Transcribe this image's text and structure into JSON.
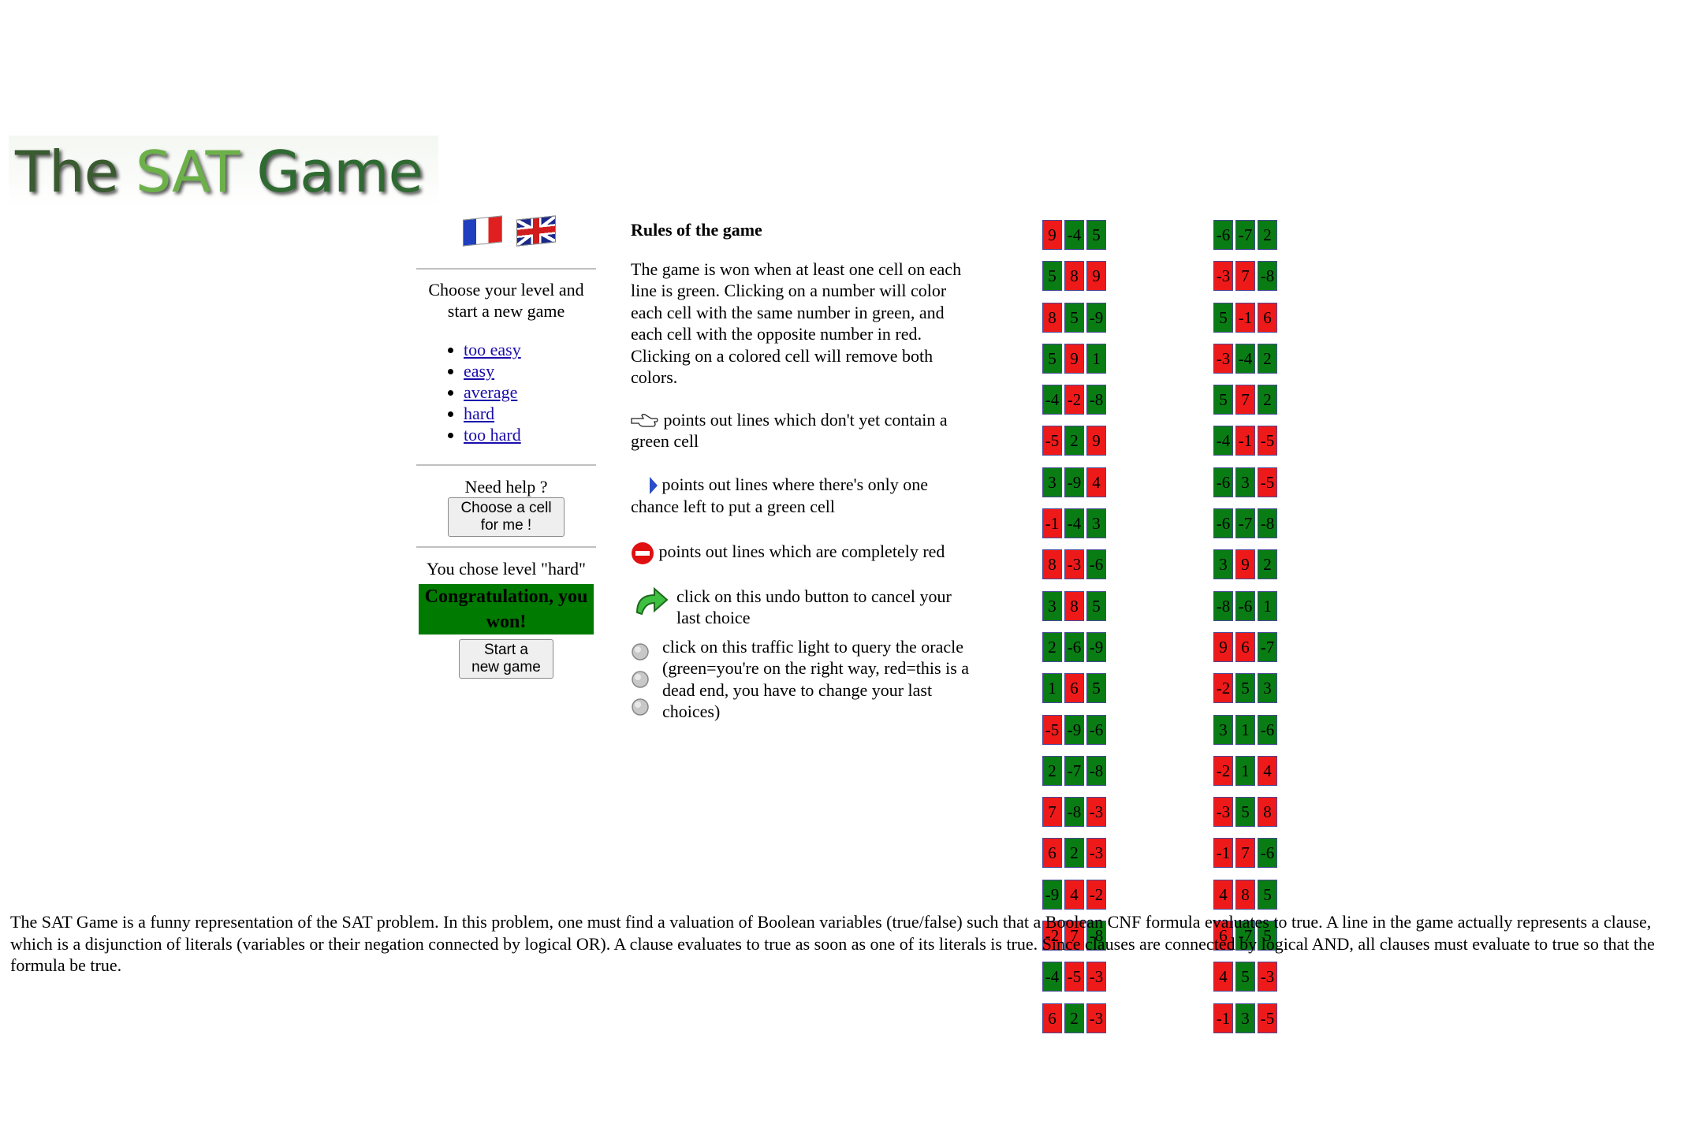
{
  "logo": {
    "the": "The",
    "sat": "SAT",
    "game": "Game"
  },
  "left": {
    "choose_text": "Choose your level and start a new game",
    "levels": [
      "too easy",
      "easy",
      "average",
      "hard",
      "too hard"
    ],
    "help_title": "Need help ?",
    "help_button": "Choose a cell for me !",
    "chosen_text": "You chose level \"hard\"",
    "congrats": "Congratulation, you won!",
    "new_game_button": "Start a new game"
  },
  "rules": {
    "title": "Rules of the game",
    "intro": "The game is won when at least one cell on each line is green. Clicking on a number will color each cell with the same number in green, and each cell with the opposite number in red. Clicking on a colored cell will remove both colors.",
    "hand_rule": "points out lines which don't yet contain a green cell",
    "arrow_rule": "points out lines where there's only one chance left to put a green cell",
    "stop_rule": "points out lines which are completely red",
    "undo_rule": "click on this undo button to cancel your last choice",
    "light_rule": "click on this traffic light to query the oracle (green=you're on the right way, red=this is a dead end, you have to change your last choices)"
  },
  "grid_left": [
    [
      [
        "9",
        "r"
      ],
      [
        "-4",
        "g"
      ],
      [
        "5",
        "g"
      ]
    ],
    [
      [
        "5",
        "g"
      ],
      [
        "8",
        "r"
      ],
      [
        "9",
        "r"
      ]
    ],
    [
      [
        "8",
        "r"
      ],
      [
        "5",
        "g"
      ],
      [
        "-9",
        "g"
      ]
    ],
    [
      [
        "5",
        "g"
      ],
      [
        "9",
        "r"
      ],
      [
        "1",
        "g"
      ]
    ],
    [
      [
        "-4",
        "g"
      ],
      [
        "-2",
        "r"
      ],
      [
        "-8",
        "g"
      ]
    ],
    [
      [
        "-5",
        "r"
      ],
      [
        "2",
        "g"
      ],
      [
        "9",
        "r"
      ]
    ],
    [
      [
        "3",
        "g"
      ],
      [
        "-9",
        "g"
      ],
      [
        "4",
        "r"
      ]
    ],
    [
      [
        "-1",
        "r"
      ],
      [
        "-4",
        "g"
      ],
      [
        "3",
        "g"
      ]
    ],
    [
      [
        "8",
        "r"
      ],
      [
        "-3",
        "r"
      ],
      [
        "-6",
        "g"
      ]
    ],
    [
      [
        "3",
        "g"
      ],
      [
        "8",
        "r"
      ],
      [
        "5",
        "g"
      ]
    ],
    [
      [
        "2",
        "g"
      ],
      [
        "-6",
        "g"
      ],
      [
        "-9",
        "g"
      ]
    ],
    [
      [
        "1",
        "g"
      ],
      [
        "6",
        "r"
      ],
      [
        "5",
        "g"
      ]
    ],
    [
      [
        "-5",
        "r"
      ],
      [
        "-9",
        "g"
      ],
      [
        "-6",
        "g"
      ]
    ],
    [
      [
        "2",
        "g"
      ],
      [
        "-7",
        "g"
      ],
      [
        "-8",
        "g"
      ]
    ],
    [
      [
        "7",
        "r"
      ],
      [
        "-8",
        "g"
      ],
      [
        "-3",
        "r"
      ]
    ],
    [
      [
        "6",
        "r"
      ],
      [
        "2",
        "g"
      ],
      [
        "-3",
        "r"
      ]
    ],
    [
      [
        "-9",
        "g"
      ],
      [
        "4",
        "r"
      ],
      [
        "-2",
        "r"
      ]
    ],
    [
      [
        "-2",
        "r"
      ],
      [
        "7",
        "r"
      ],
      [
        "-8",
        "g"
      ]
    ],
    [
      [
        "-4",
        "g"
      ],
      [
        "-5",
        "r"
      ],
      [
        "-3",
        "r"
      ]
    ],
    [
      [
        "6",
        "r"
      ],
      [
        "2",
        "g"
      ],
      [
        "-3",
        "r"
      ]
    ]
  ],
  "grid_right": [
    [
      [
        "-6",
        "g"
      ],
      [
        "-7",
        "g"
      ],
      [
        "2",
        "g"
      ]
    ],
    [
      [
        "-3",
        "r"
      ],
      [
        "7",
        "r"
      ],
      [
        "-8",
        "g"
      ]
    ],
    [
      [
        "5",
        "g"
      ],
      [
        "-1",
        "r"
      ],
      [
        "6",
        "r"
      ]
    ],
    [
      [
        "-3",
        "r"
      ],
      [
        "-4",
        "g"
      ],
      [
        "2",
        "g"
      ]
    ],
    [
      [
        "5",
        "g"
      ],
      [
        "7",
        "r"
      ],
      [
        "2",
        "g"
      ]
    ],
    [
      [
        "-4",
        "g"
      ],
      [
        "-1",
        "r"
      ],
      [
        "-5",
        "r"
      ]
    ],
    [
      [
        "-6",
        "g"
      ],
      [
        "3",
        "g"
      ],
      [
        "-5",
        "r"
      ]
    ],
    [
      [
        "-6",
        "g"
      ],
      [
        "-7",
        "g"
      ],
      [
        "-8",
        "g"
      ]
    ],
    [
      [
        "3",
        "g"
      ],
      [
        "9",
        "r"
      ],
      [
        "2",
        "g"
      ]
    ],
    [
      [
        "-8",
        "g"
      ],
      [
        "-6",
        "g"
      ],
      [
        "1",
        "g"
      ]
    ],
    [
      [
        "9",
        "r"
      ],
      [
        "6",
        "r"
      ],
      [
        "-7",
        "g"
      ]
    ],
    [
      [
        "-2",
        "r"
      ],
      [
        "5",
        "g"
      ],
      [
        "3",
        "g"
      ]
    ],
    [
      [
        "3",
        "g"
      ],
      [
        "1",
        "g"
      ],
      [
        "-6",
        "g"
      ]
    ],
    [
      [
        "-2",
        "r"
      ],
      [
        "1",
        "g"
      ],
      [
        "4",
        "r"
      ]
    ],
    [
      [
        "-3",
        "r"
      ],
      [
        "5",
        "g"
      ],
      [
        "8",
        "r"
      ]
    ],
    [
      [
        "-1",
        "r"
      ],
      [
        "7",
        "r"
      ],
      [
        "-6",
        "g"
      ]
    ],
    [
      [
        "4",
        "r"
      ],
      [
        "8",
        "r"
      ],
      [
        "5",
        "g"
      ]
    ],
    [
      [
        "6",
        "r"
      ],
      [
        "-7",
        "g"
      ],
      [
        "5",
        "g"
      ]
    ],
    [
      [
        "4",
        "r"
      ],
      [
        "5",
        "g"
      ],
      [
        "-3",
        "r"
      ]
    ],
    [
      [
        "-1",
        "r"
      ],
      [
        "3",
        "g"
      ],
      [
        "-5",
        "r"
      ]
    ]
  ],
  "footer": "The SAT Game is a funny representation of the SAT problem. In this problem, one must find a valuation of Boolean variables (true/false) such that a Boolean CNF formula evaluates to true. A line in the game actually represents a clause, which is a disjunction of literals (variables or their negation connected by logical OR). A clause evaluates to true as soon as one of its literals is true. Since clauses are connected by logical AND, all clauses must evaluate to true so that the formula be true."
}
